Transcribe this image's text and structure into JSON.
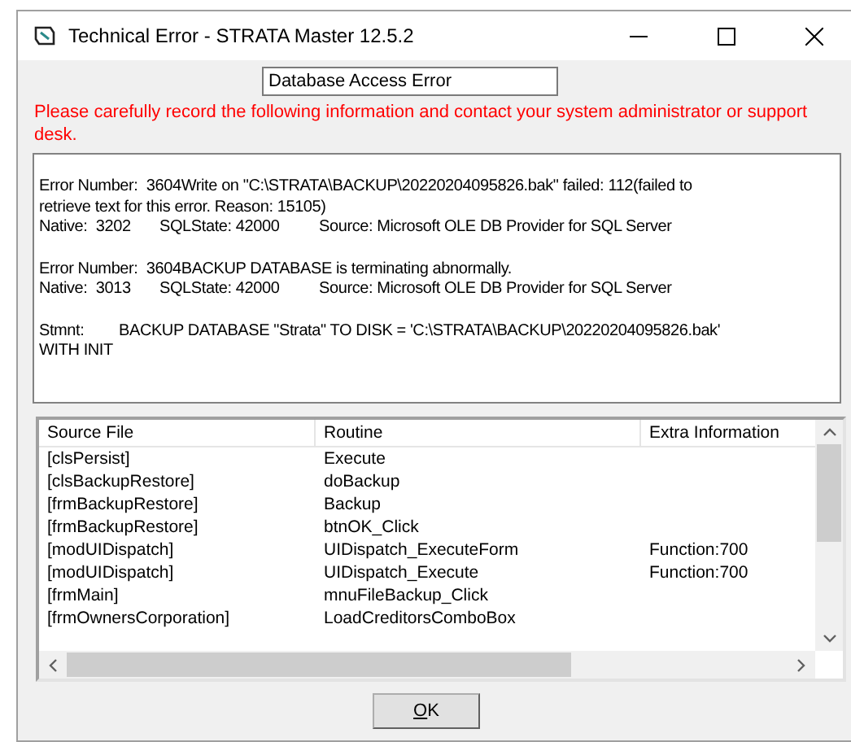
{
  "window": {
    "title": "Technical Error - STRATA Master 12.5.2"
  },
  "error_title": "Database Access Error",
  "instruction": "Please carefully record the following information and contact your system administrator or support desk.",
  "details": [
    [
      {
        "kind": "plain",
        "cells": [
          "Error Number:  3604Write on \"C:\\STRATA\\BACKUP\\20220204095826.bak\" failed: 112(failed to"
        ]
      },
      {
        "kind": "plain",
        "cells": [
          "retrieve text for this error. Reason: 15105)"
        ]
      },
      {
        "kind": "native",
        "cells": [
          "Native:  3202",
          "SQLState: 42000",
          "Source: Microsoft OLE DB Provider for SQL Server"
        ]
      }
    ],
    [
      {
        "kind": "plain",
        "cells": [
          "Error Number:  3604BACKUP DATABASE is terminating abnormally."
        ]
      },
      {
        "kind": "native",
        "cells": [
          "Native:  3013",
          "SQLState: 42000",
          "Source: Microsoft OLE DB Provider for SQL Server"
        ]
      }
    ],
    [
      {
        "kind": "stmnt",
        "cells": [
          "Stmnt:",
          "BACKUP DATABASE \"Strata\" TO DISK = 'C:\\STRATA\\BACKUP\\20220204095826.bak'"
        ]
      },
      {
        "kind": "plain",
        "cells": [
          "WITH INIT"
        ]
      }
    ]
  ],
  "table": {
    "columns": [
      "Source File",
      "Routine",
      "Extra Information"
    ],
    "rows": [
      [
        "[clsPersist]",
        "Execute",
        ""
      ],
      [
        "[clsBackupRestore]",
        "doBackup",
        ""
      ],
      [
        "[frmBackupRestore]",
        "Backup",
        ""
      ],
      [
        "[frmBackupRestore]",
        "btnOK_Click",
        ""
      ],
      [
        "[modUIDispatch]",
        "UIDispatch_ExecuteForm",
        "Function:700"
      ],
      [
        "[modUIDispatch]",
        "UIDispatch_Execute",
        "Function:700"
      ],
      [
        "[frmMain]",
        "mnuFileBackup_Click",
        ""
      ],
      [
        "[frmOwnersCorporation]",
        "LoadCreditorsComboBox",
        ""
      ]
    ]
  },
  "buttons": [
    "OK"
  ]
}
